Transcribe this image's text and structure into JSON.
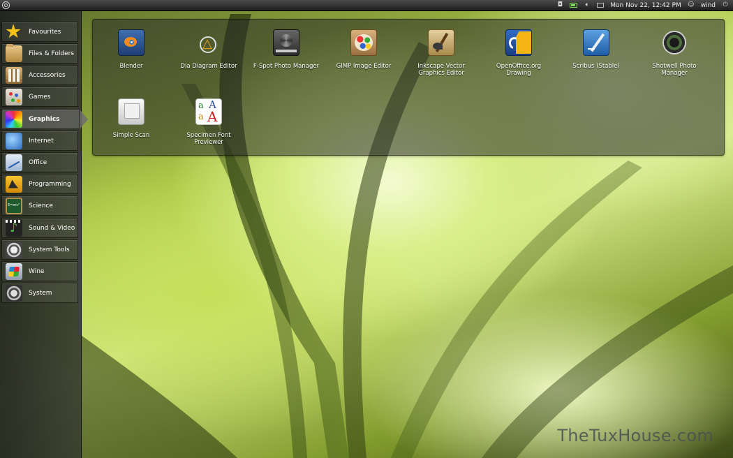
{
  "top_panel": {
    "logo_icon": "ubuntu-logo-icon",
    "tray_icons": [
      "indicator-icon",
      "battery-icon",
      "volume-icon",
      "mail-icon"
    ],
    "datetime": "Mon Nov 22, 12:42 PM",
    "user": "wind",
    "session_icon": "power-icon"
  },
  "sidebar": {
    "items": [
      {
        "label": "Favourites",
        "icon": "star-icon"
      },
      {
        "label": "Files & Folders",
        "icon": "folder-icon"
      },
      {
        "label": "Accessories",
        "icon": "calculator-icon"
      },
      {
        "label": "Games",
        "icon": "game-icon"
      },
      {
        "label": "Graphics",
        "icon": "palette-icon",
        "active": true
      },
      {
        "label": "Internet",
        "icon": "globe-icon"
      },
      {
        "label": "Office",
        "icon": "chart-icon"
      },
      {
        "label": "Programming",
        "icon": "construction-icon"
      },
      {
        "label": "Science",
        "icon": "chalkboard-icon"
      },
      {
        "label": "Sound & Video",
        "icon": "music-icon"
      },
      {
        "label": "System Tools",
        "icon": "tools-icon"
      },
      {
        "label": "Wine",
        "icon": "wine-icon"
      },
      {
        "label": "System",
        "icon": "system-icon"
      }
    ]
  },
  "apps": {
    "items": [
      {
        "label": "Blender",
        "icon": "blender-icon"
      },
      {
        "label": "Dia Diagram Editor",
        "icon": "dia-icon"
      },
      {
        "label": "F-Spot Photo Manager",
        "icon": "fspot-icon"
      },
      {
        "label": "GIMP Image Editor",
        "icon": "gimp-icon"
      },
      {
        "label": "Inkscape Vector Graphics Editor",
        "icon": "inkscape-icon"
      },
      {
        "label": "OpenOffice.org Drawing",
        "icon": "openoffice-draw-icon"
      },
      {
        "label": "Scribus (Stable)",
        "icon": "scribus-icon"
      },
      {
        "label": "Shotwell Photo Manager",
        "icon": "shotwell-icon"
      },
      {
        "label": "Simple Scan",
        "icon": "scanner-icon"
      },
      {
        "label": "Specimen Font Previewer",
        "icon": "font-icon"
      }
    ]
  },
  "specimen_glyphs": [
    "a",
    "A",
    "a",
    "A"
  ],
  "watermark": "TheTuxHouse.com",
  "colors": {
    "panel_bg": "#2a2a2a",
    "accent_star": "#f2c21a",
    "watermark": "#46504f"
  }
}
